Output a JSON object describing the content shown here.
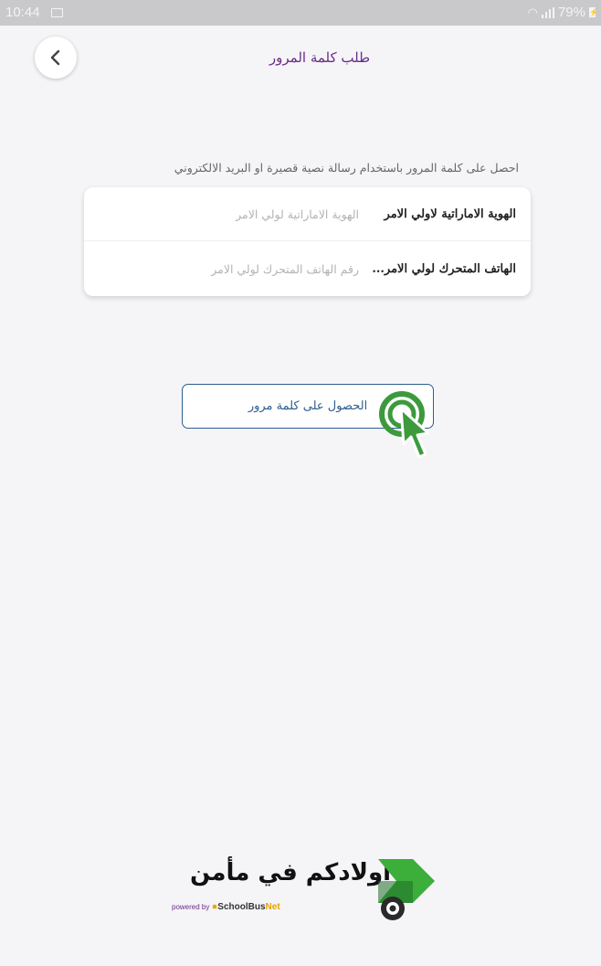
{
  "status_bar": {
    "time": "10:44",
    "battery": "79%",
    "icons": [
      "image-icon",
      "wifi-icon",
      "signal-icon",
      "battery-charging-icon"
    ]
  },
  "header": {
    "title": "طلب كلمة المرور",
    "back_icon": "chevron-left-icon"
  },
  "instruction": "احصل على كلمة المرور باستخدام رسالة نصية قصيرة او البريد الالكتروني",
  "form": {
    "emirates_id": {
      "label": "الهوية الاماراتية لاولي الامر",
      "placeholder": "الهوية الاماراتية لولي الامر",
      "value": ""
    },
    "mobile": {
      "label": "الهاتف المتحرك لولي الامر...",
      "placeholder": "رقم الهاتف المتحرك لولي الامر",
      "value": ""
    }
  },
  "submit_label": "الحصول على كلمة مرور",
  "footer": {
    "slogan": "اولادكم في مأمن",
    "powered_by": "powered by",
    "brand_school": "SchoolBus",
    "brand_net": "Net"
  },
  "colors": {
    "title": "#6a2a8a",
    "button_border": "#2c5d8f",
    "cursor_green": "#3c9a3c",
    "logo_green": "#3cae3a",
    "logo_dark_green": "#1f6e2a"
  }
}
